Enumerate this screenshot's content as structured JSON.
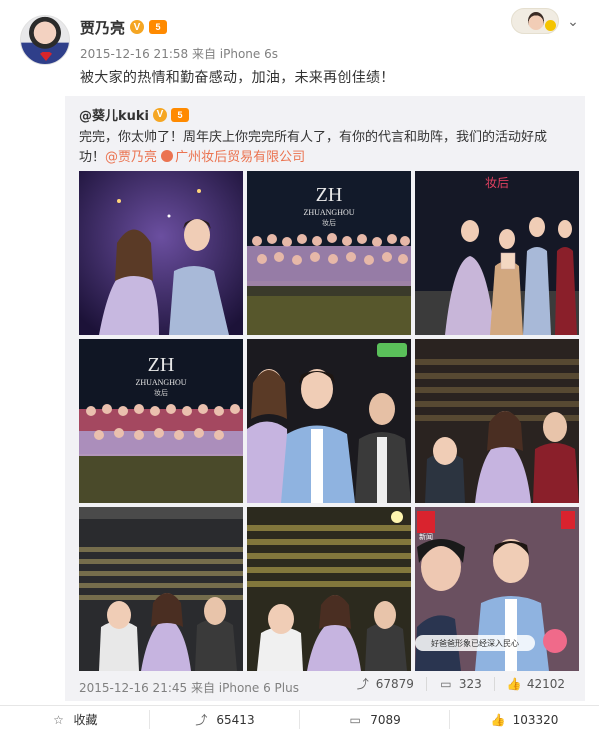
{
  "post": {
    "author": "贾乃亮",
    "verified_mark": "V",
    "vip_mark": "5",
    "timestamp": "2015-12-16 21:58",
    "source": "来自 iPhone 6s",
    "text": "被大家的热情和勤奋感动，加油，未来再创佳绩！"
  },
  "repost": {
    "author": "@葵儿kuki",
    "verified_mark": "V",
    "vip_mark": "5",
    "text_before": "完完，你太帅了！周年庆上你完完所有人了，有你的代言和助阵，我们的活动好成功！",
    "mention_1": "@贾乃亮",
    "mention_2": "广州妆后贸易有限公司",
    "timestamp": "2015-12-16 21:45",
    "source": "来自 iPhone 6 Plus",
    "repost_count": "67879",
    "comment_count": "323",
    "like_count": "42102",
    "photos": [
      {
        "desc": "couple-on-stage"
      },
      {
        "desc": "ZH group photo",
        "logo": "ZH",
        "logo_sub": "ZHUANGHOU",
        "logo_cn": "妆后"
      },
      {
        "desc": "stage-award",
        "brand": "妆后"
      },
      {
        "desc": "ZH group photo 2",
        "logo": "ZH",
        "logo_sub": "ZHUANGHOU",
        "logo_cn": "妆后"
      },
      {
        "desc": "three-people-closeup"
      },
      {
        "desc": "selfie-crowd"
      },
      {
        "desc": "audience-selfie-1"
      },
      {
        "desc": "audience-selfie-2"
      },
      {
        "desc": "tv-news-frame",
        "tv_tag": "新闻",
        "caption": "好爸爸形象已经深入民心"
      }
    ]
  },
  "actions": {
    "favorite_label": "收藏",
    "repost_count": "65413",
    "comment_count": "7089",
    "like_count": "103320"
  },
  "colors": {
    "accent": "#eb7350",
    "verified": "#f5a623",
    "vip": "#ff8a00",
    "repost_bg": "#f2f2f5"
  }
}
